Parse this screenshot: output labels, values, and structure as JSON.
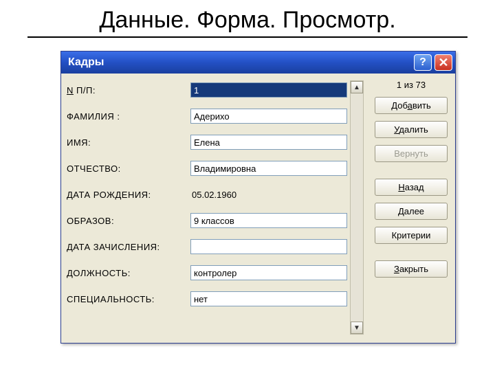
{
  "slide_title": "Данные. Форма. Просмотр.",
  "window": {
    "title": "Кадры"
  },
  "counter": "1 из 73",
  "fields": {
    "n_pp": {
      "label": "N П/П:",
      "value": "1",
      "kind": "input",
      "highlight": true
    },
    "fam": {
      "label": "ФАМИЛИЯ   :",
      "value": "Адерихо",
      "kind": "input"
    },
    "name": {
      "label": "ИМЯ:",
      "value": "Елена",
      "kind": "input"
    },
    "otch": {
      "label": "ОТЧЕСТВО:",
      "value": "Владимировна",
      "kind": "input"
    },
    "birth": {
      "label": "ДАТА РОЖДЕНИЯ:",
      "value": "05.02.1960",
      "kind": "static"
    },
    "educ": {
      "label": "ОБРАЗОВ:",
      "value": "9 классов",
      "kind": "input"
    },
    "enroll": {
      "label": "ДАТА ЗАЧИСЛЕНИЯ:",
      "value": "",
      "kind": "input"
    },
    "post": {
      "label": "ДОЛЖНОСТЬ:",
      "value": "контролер",
      "kind": "input"
    },
    "spec": {
      "label": "СПЕЦИАЛЬНОСТЬ:",
      "value": "нет",
      "kind": "input"
    }
  },
  "buttons": {
    "add": "Добавить",
    "delete": "Удалить",
    "revert": "Вернуть",
    "back": "Назад",
    "next": "Далее",
    "criteria": "Критерии",
    "close": "Закрыть"
  }
}
